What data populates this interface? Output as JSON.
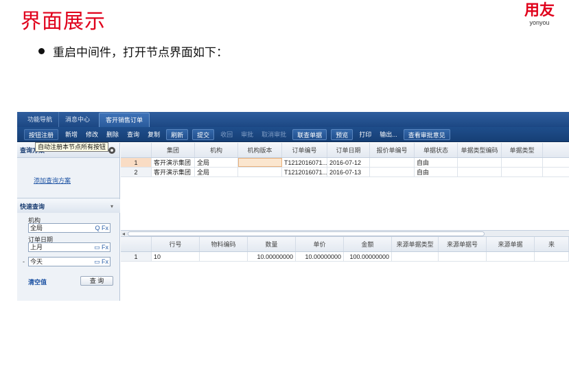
{
  "slide": {
    "title": "界面展示",
    "logo_main": "用友",
    "logo_sub": "yonyou",
    "bullet": "重启中间件，打开节点界面如下："
  },
  "tabs": [
    "功能导航",
    "消息中心",
    "客开销售订单"
  ],
  "toolbar": {
    "buttons": [
      "按钮注册",
      "新增",
      "修改",
      "删除",
      "查询",
      "复制",
      "刷新",
      "提交",
      "收回",
      "审批",
      "取消审批",
      "联查单据",
      "预览",
      "打印",
      "输出...",
      "查看审批意见"
    ],
    "tooltip": "自动注册本节点所有按钮"
  },
  "left_panel": {
    "query_scheme_title": "查询方案",
    "add_scheme_link": "添加查询方案",
    "quick_query_title": "快速查询",
    "org_label": "机构",
    "org_value": "全局",
    "date_label": "订单日期",
    "date_from": "上月",
    "date_to": "今天",
    "dash": "-",
    "clear_label": "清空值",
    "query_button": "查 询",
    "fx_search_icon": "Q Fx",
    "fx_cal_icon": "▭ Fx"
  },
  "header_grid": {
    "columns": [
      "",
      "集团",
      "机构",
      "机构版本",
      "订单编号",
      "订单日期",
      "报价单编号",
      "单据状态",
      "单据类型编码",
      "单据类型"
    ],
    "rows": [
      [
        "1",
        "客开演示集团",
        "全局",
        "",
        "T1212016071...",
        "2016-07-12",
        "",
        "自由",
        "",
        ""
      ],
      [
        "2",
        "客开演示集团",
        "全局",
        "",
        "T1212016071...",
        "2016-07-13",
        "",
        "自由",
        "",
        ""
      ]
    ]
  },
  "body_grid": {
    "columns": [
      "",
      "行号",
      "物料编码",
      "数量",
      "单价",
      "金额",
      "来源单据类型",
      "来源单据号",
      "来源单据",
      "来"
    ],
    "rows": [
      [
        "1",
        "10",
        "",
        "10.00000000",
        "10.00000000",
        "100.00000000",
        "",
        "",
        "",
        ""
      ]
    ]
  },
  "colors": {
    "brand_red": "#e0001b",
    "toolbar_blue": "#1f4e8c",
    "selection_orange": "#f9dcc4"
  }
}
